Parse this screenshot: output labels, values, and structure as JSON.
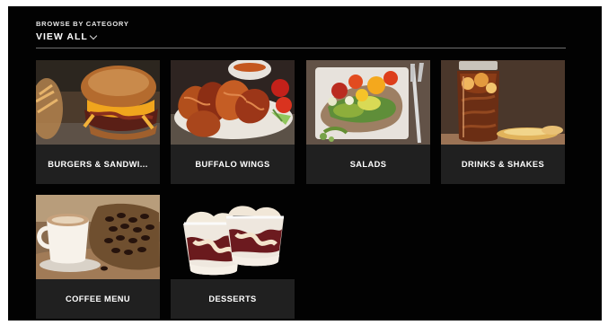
{
  "header": {
    "subtitle": "BROWSE BY CATEGORY",
    "view_all": "VIEW ALL"
  },
  "categories": [
    {
      "label": "BURGERS & SANDWI...",
      "image": "burger-photo"
    },
    {
      "label": "BUFFALO WINGS",
      "image": "buffalo-wings-photo"
    },
    {
      "label": "SALADS",
      "image": "salad-photo"
    },
    {
      "label": "DRINKS & SHAKES",
      "image": "drink-jar-photo"
    },
    {
      "label": "COFFEE MENU",
      "image": "coffee-cup-photo"
    },
    {
      "label": "DESSERTS",
      "image": "dessert-cups-photo"
    }
  ],
  "colors": {
    "background": "#020202",
    "tile": "#202020",
    "divider": "#6f6f6f"
  }
}
